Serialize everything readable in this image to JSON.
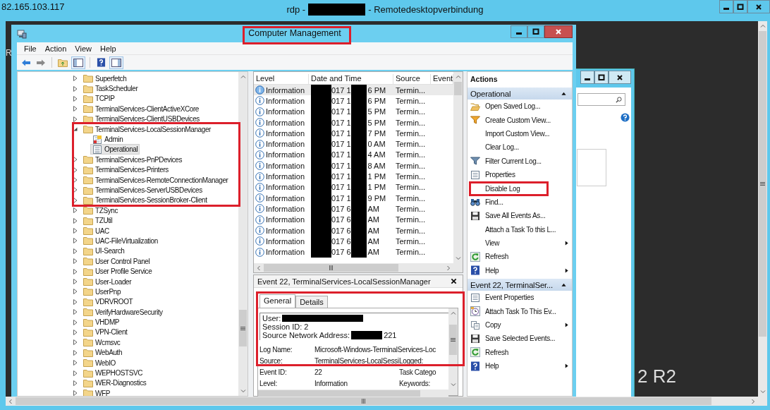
{
  "rdp": {
    "host": "82.165.103.117",
    "title_prefix": "rdp -",
    "title_suffix": "- Remotedesktopverbindung"
  },
  "desktop": {
    "corner_text": "R",
    "edition_text": "2 R2"
  },
  "window": {
    "title": "Computer Management"
  },
  "menu": [
    "File",
    "Action",
    "View",
    "Help"
  ],
  "tree": [
    {
      "label": "Superfetch",
      "expanded": false,
      "selected": false
    },
    {
      "label": "TaskScheduler",
      "expanded": false,
      "selected": false
    },
    {
      "label": "TCPIP",
      "expanded": false,
      "selected": false
    },
    {
      "label": "TerminalServices-ClientActiveXCore",
      "expanded": false,
      "selected": false
    },
    {
      "label": "TerminalServices-ClientUSBDevices",
      "expanded": false,
      "selected": false
    },
    {
      "label": "TerminalServices-LocalSessionManager",
      "expanded": true,
      "selected": false,
      "children": [
        {
          "label": "Admin",
          "kind": "admin",
          "selected": false
        },
        {
          "label": "Operational",
          "kind": "log",
          "selected": true
        }
      ]
    },
    {
      "label": "TerminalServices-PnPDevices",
      "expanded": false,
      "selected": false
    },
    {
      "label": "TerminalServices-Printers",
      "expanded": false,
      "selected": false
    },
    {
      "label": "TerminalServices-RemoteConnectionManager",
      "expanded": false,
      "selected": false
    },
    {
      "label": "TerminalServices-ServerUSBDevices",
      "expanded": false,
      "selected": false
    },
    {
      "label": "TerminalServices-SessionBroker-Client",
      "expanded": false,
      "selected": false
    },
    {
      "label": "TZSync",
      "expanded": false,
      "selected": false
    },
    {
      "label": "TZUtil",
      "expanded": false,
      "selected": false
    },
    {
      "label": "UAC",
      "expanded": false,
      "selected": false
    },
    {
      "label": "UAC-FileVirtualization",
      "expanded": false,
      "selected": false
    },
    {
      "label": "UI-Search",
      "expanded": false,
      "selected": false
    },
    {
      "label": "User Control Panel",
      "expanded": false,
      "selected": false
    },
    {
      "label": "User Profile Service",
      "expanded": false,
      "selected": false
    },
    {
      "label": "User-Loader",
      "expanded": false,
      "selected": false
    },
    {
      "label": "UserPnp",
      "expanded": false,
      "selected": false
    },
    {
      "label": "VDRVROOT",
      "expanded": false,
      "selected": false
    },
    {
      "label": "VerifyHardwareSecurity",
      "expanded": false,
      "selected": false
    },
    {
      "label": "VHDMP",
      "expanded": false,
      "selected": false
    },
    {
      "label": "VPN-Client",
      "expanded": false,
      "selected": false
    },
    {
      "label": "Wcmsvc",
      "expanded": false,
      "selected": false
    },
    {
      "label": "WebAuth",
      "expanded": false,
      "selected": false
    },
    {
      "label": "WebIO",
      "expanded": false,
      "selected": false
    },
    {
      "label": "WEPHOSTSVC",
      "expanded": false,
      "selected": false
    },
    {
      "label": "WER-Diagnostics",
      "expanded": false,
      "selected": false
    },
    {
      "label": "WFP",
      "expanded": false,
      "selected": false
    }
  ],
  "events": {
    "columns": [
      "Level",
      "Date and Time",
      "Source",
      "Event"
    ],
    "rows": [
      {
        "level": "Information",
        "date_start": "017 1",
        "date_end": "6 PM",
        "source": "Termin...",
        "selected": true
      },
      {
        "level": "Information",
        "date_start": "017 1",
        "date_end": "6 PM",
        "source": "Termin...",
        "selected": false
      },
      {
        "level": "Information",
        "date_start": "017 1",
        "date_end": "5 PM",
        "source": "Termin...",
        "selected": false
      },
      {
        "level": "Information",
        "date_start": "017 1",
        "date_end": "5 PM",
        "source": "Termin...",
        "selected": false
      },
      {
        "level": "Information",
        "date_start": "017 1",
        "date_end": "7 PM",
        "source": "Termin...",
        "selected": false
      },
      {
        "level": "Information",
        "date_start": "017 1",
        "date_end": "0 AM",
        "source": "Termin...",
        "selected": false
      },
      {
        "level": "Information",
        "date_start": "017 1",
        "date_end": "4 AM",
        "source": "Termin...",
        "selected": false
      },
      {
        "level": "Information",
        "date_start": "017 1",
        "date_end": "8 AM",
        "source": "Termin...",
        "selected": false
      },
      {
        "level": "Information",
        "date_start": "017 1",
        "date_end": "1 PM",
        "source": "Termin...",
        "selected": false
      },
      {
        "level": "Information",
        "date_start": "017 1",
        "date_end": "1 PM",
        "source": "Termin...",
        "selected": false
      },
      {
        "level": "Information",
        "date_start": "017 1",
        "date_end": "9 PM",
        "source": "Termin...",
        "selected": false
      },
      {
        "level": "Information",
        "date_start": "017 6",
        "date_end": "AM",
        "source": "Termin...",
        "selected": false
      },
      {
        "level": "Information",
        "date_start": "017 6",
        "date_end": "AM",
        "source": "Termin...",
        "selected": false
      },
      {
        "level": "Information",
        "date_start": "017 6",
        "date_end": "AM",
        "source": "Termin...",
        "selected": false
      },
      {
        "level": "Information",
        "date_start": "017 6",
        "date_end": "AM",
        "source": "Termin...",
        "selected": false
      },
      {
        "level": "Information",
        "date_start": "017 6",
        "date_end": "AM",
        "source": "Termin...",
        "selected": false
      }
    ]
  },
  "detail": {
    "title": "Event 22, TerminalServices-LocalSessionManager",
    "tabs": [
      {
        "label": "General",
        "selected": true
      },
      {
        "label": "Details",
        "selected": false
      }
    ],
    "user_label": "User:",
    "session": "Session ID: 2",
    "address_label": "Source Network Address:",
    "address_tail": "221",
    "fields": [
      {
        "label": "Log Name:",
        "value": "Microsoft-Windows-TerminalServices-Loc"
      },
      {
        "label": "Source:",
        "value": "TerminalServices-LocalSessi",
        "label2": "Logged:"
      },
      {
        "label": "Event ID:",
        "value": "22",
        "label2": "Task Catego"
      },
      {
        "label": "Level:",
        "value": "Information",
        "label2": "Keywords:"
      }
    ]
  },
  "actions": {
    "title": "Actions",
    "sections": [
      {
        "title": "Operational",
        "items": [
          {
            "label": "Open Saved Log...",
            "kind": "open",
            "submenu": false
          },
          {
            "label": "Create Custom View...",
            "kind": "custom-view",
            "submenu": false
          },
          {
            "label": "Import Custom View...",
            "kind": "none",
            "submenu": false
          },
          {
            "label": "Clear Log...",
            "kind": "none",
            "submenu": false
          },
          {
            "label": "Filter Current Log...",
            "kind": "filter",
            "submenu": false
          },
          {
            "label": "Properties",
            "kind": "properties",
            "submenu": false
          },
          {
            "label": "Disable Log",
            "kind": "none",
            "submenu": false
          },
          {
            "label": "Find...",
            "kind": "find",
            "submenu": false
          },
          {
            "label": "Save All Events As...",
            "kind": "save",
            "submenu": false
          },
          {
            "label": "Attach a Task To this L...",
            "kind": "none",
            "submenu": false
          },
          {
            "label": "View",
            "kind": "none",
            "submenu": true
          },
          {
            "label": "Refresh",
            "kind": "refresh",
            "submenu": false
          },
          {
            "label": "Help",
            "kind": "help",
            "submenu": true
          }
        ]
      },
      {
        "title": "Event 22, TerminalSer...",
        "items": [
          {
            "label": "Event Properties",
            "kind": "properties",
            "submenu": false
          },
          {
            "label": "Attach Task To This Ev...",
            "kind": "task",
            "submenu": false
          },
          {
            "label": "Copy",
            "kind": "copy",
            "submenu": true
          },
          {
            "label": "Save Selected Events...",
            "kind": "save",
            "submenu": false
          },
          {
            "label": "Refresh",
            "kind": "refresh",
            "submenu": false
          },
          {
            "label": "Help",
            "kind": "help",
            "submenu": true
          }
        ]
      }
    ]
  }
}
